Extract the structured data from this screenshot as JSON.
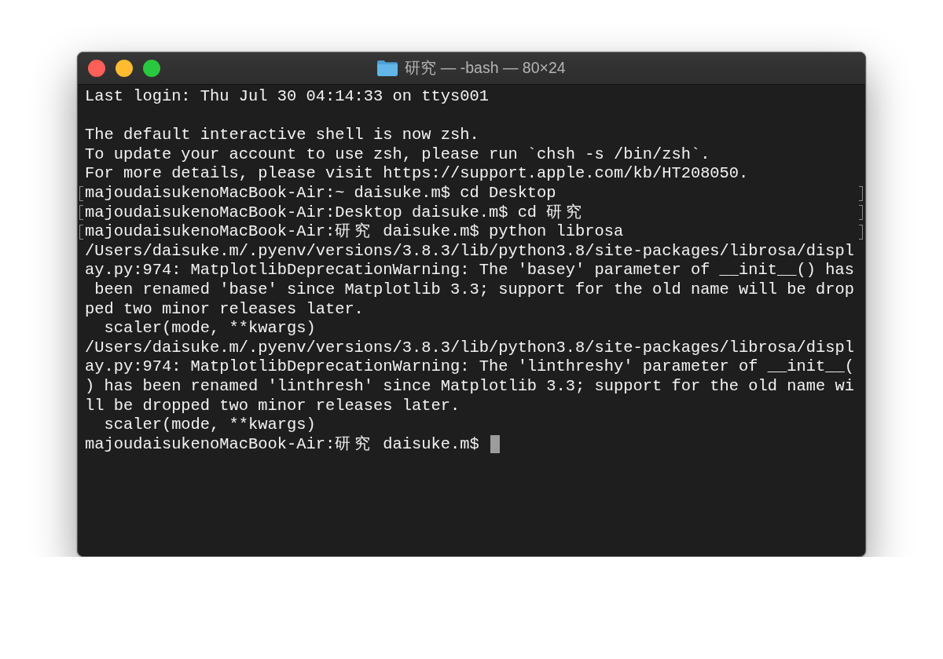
{
  "window": {
    "title": "研究 — -bash — 80×24"
  },
  "terminal": {
    "lines": [
      {
        "kind": "text",
        "text": "Last login: Thu Jul 30 04:14:33 on ttys001",
        "marked": false
      },
      {
        "kind": "blank"
      },
      {
        "kind": "text",
        "text": "The default interactive shell is now zsh.",
        "marked": false
      },
      {
        "kind": "text",
        "text": "To update your account to use zsh, please run `chsh -s /bin/zsh`.",
        "marked": false
      },
      {
        "kind": "text",
        "text": "For more details, please visit https://support.apple.com/kb/HT208050.",
        "marked": false
      },
      {
        "kind": "text",
        "text": "majoudaisukenoMacBook-Air:~ daisuke.m$ cd Desktop",
        "marked": true
      },
      {
        "kind": "text",
        "text": "majoudaisukenoMacBook-Air:Desktop daisuke.m$ cd 研究",
        "marked": true
      },
      {
        "kind": "text",
        "text": "majoudaisukenoMacBook-Air:研究 daisuke.m$ python librosa",
        "marked": true
      },
      {
        "kind": "text",
        "text": "/Users/daisuke.m/.pyenv/versions/3.8.3/lib/python3.8/site-packages/librosa/displ",
        "marked": false
      },
      {
        "kind": "text",
        "text": "ay.py:974: MatplotlibDeprecationWarning: The 'basey' parameter of __init__() has",
        "marked": false
      },
      {
        "kind": "text",
        "text": " been renamed 'base' since Matplotlib 3.3; support for the old name will be drop",
        "marked": false
      },
      {
        "kind": "text",
        "text": "ped two minor releases later.",
        "marked": false
      },
      {
        "kind": "text",
        "text": "  scaler(mode, **kwargs)",
        "marked": false
      },
      {
        "kind": "text",
        "text": "/Users/daisuke.m/.pyenv/versions/3.8.3/lib/python3.8/site-packages/librosa/displ",
        "marked": false
      },
      {
        "kind": "text",
        "text": "ay.py:974: MatplotlibDeprecationWarning: The 'linthreshy' parameter of __init__(",
        "marked": false
      },
      {
        "kind": "text",
        "text": ") has been renamed 'linthresh' since Matplotlib 3.3; support for the old name wi",
        "marked": false
      },
      {
        "kind": "text",
        "text": "ll be dropped two minor releases later.",
        "marked": false
      },
      {
        "kind": "text",
        "text": "  scaler(mode, **kwargs)",
        "marked": false
      },
      {
        "kind": "text",
        "text": "majoudaisukenoMacBook-Air:研究 daisuke.m$",
        "marked": false
      }
    ],
    "cursor": true
  }
}
